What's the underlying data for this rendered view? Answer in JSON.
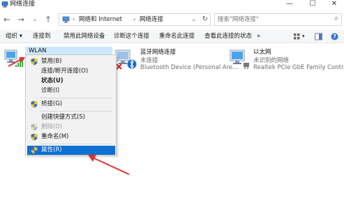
{
  "window": {
    "title": "网络连接",
    "minimize": "—",
    "maximize": "☐",
    "close": "✕"
  },
  "address": {
    "crumbs": [
      "网络和 Internet",
      "网络连接"
    ],
    "separator": "›",
    "dropdown_glyph": "⌄",
    "refresh_glyph": "↻"
  },
  "search": {
    "placeholder": "搜索\"网络连接\"",
    "icon": "search-icon"
  },
  "commands": {
    "organize": "组织 ▾",
    "connect": "连接到",
    "disable": "禁用此网络设备",
    "diagnose": "诊断这个连接",
    "rename": "重命名此连接",
    "status": "查看此连接的状态",
    "more": "»"
  },
  "connections": [
    {
      "name": "WLAN",
      "status": "",
      "device": ""
    },
    {
      "name": "蓝牙网络连接",
      "status": "未连接",
      "device": "Bluetooth Device (Personal Are..."
    },
    {
      "name": "以太网",
      "status": "未识别的网络",
      "device": "Realtek PCIe GbE Family Contr..."
    }
  ],
  "context_menu": {
    "items": [
      {
        "label": "禁用(B)",
        "shield": true,
        "style": "normal"
      },
      {
        "label": "连接/断开连接(O)",
        "shield": false,
        "style": "normal"
      },
      {
        "label": "状态(U)",
        "shield": false,
        "style": "bold"
      },
      {
        "label": "诊断(I)",
        "shield": false,
        "style": "normal"
      },
      {
        "label": "桥接(G)",
        "shield": true,
        "style": "normal"
      },
      {
        "label": "创建快捷方式(S)",
        "shield": false,
        "style": "normal"
      },
      {
        "label": "删除(D)",
        "shield": true,
        "style": "disabled"
      },
      {
        "label": "重命名(M)",
        "shield": true,
        "style": "normal"
      },
      {
        "label": "属性(R)",
        "shield": true,
        "style": "highlighted"
      }
    ]
  },
  "colors": {
    "accent": "#0b6fd4",
    "selection": "#cce8ff",
    "annotation_arrow": "#e0302e"
  }
}
